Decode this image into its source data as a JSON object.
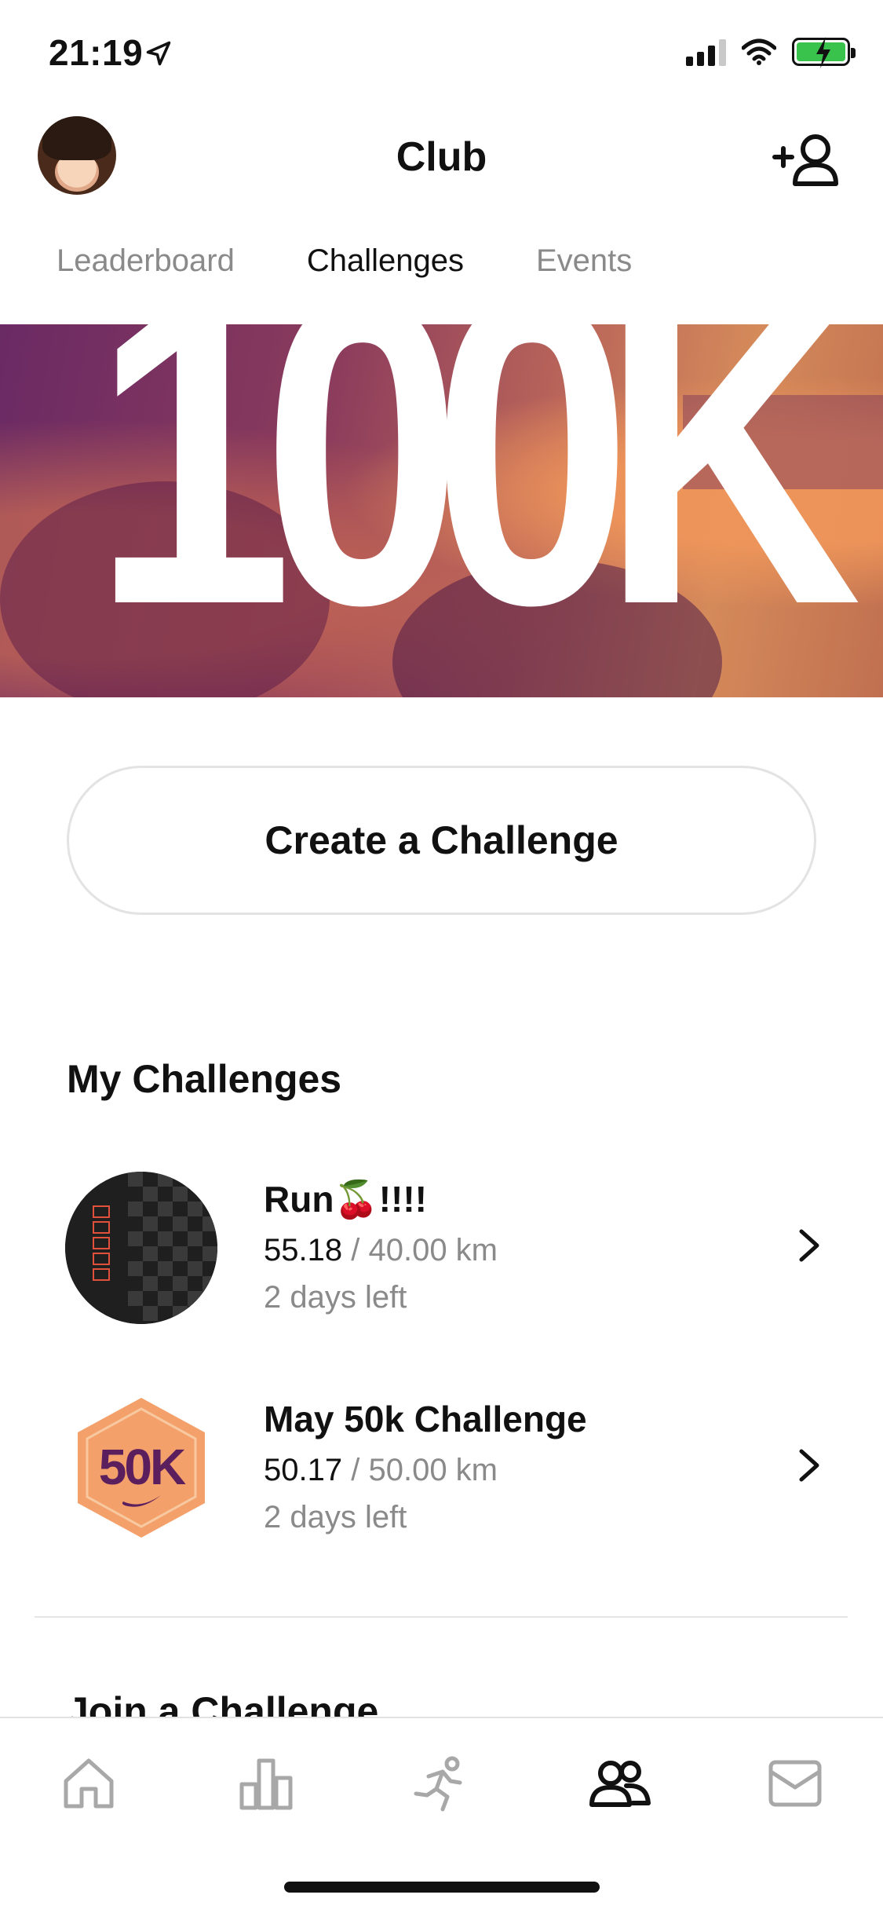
{
  "status_bar": {
    "time": "21:19",
    "battery_color": "#39c34d"
  },
  "header": {
    "title": "Club"
  },
  "tabs": [
    {
      "label": "Leaderboard",
      "active": false
    },
    {
      "label": "Challenges",
      "active": true
    },
    {
      "label": "Events",
      "active": false
    }
  ],
  "hero": {
    "text": "100K",
    "colors": [
      "#6a2a64",
      "#d58a5a"
    ]
  },
  "create_button": {
    "label": "Create a Challenge"
  },
  "my_challenges": {
    "title": "My Challenges",
    "items": [
      {
        "title": "Run🍒!!!!",
        "progress": "55.18",
        "goal": "/ 40.00 km",
        "days_left": "2 days left",
        "badge": "checkered-badge"
      },
      {
        "title": "May 50k Challenge",
        "progress": "50.17",
        "goal": "/ 50.00 km",
        "days_left": "2 days left",
        "badge_text": "50K",
        "badge": "50k-hexagon-badge"
      }
    ]
  },
  "join": {
    "title": "Join a Challenge"
  },
  "tabbar": {
    "items": [
      "home-icon",
      "activity-icon",
      "run-icon",
      "club-icon",
      "inbox-icon"
    ],
    "active": "club-icon"
  },
  "colors": {
    "accent": "#111111",
    "muted": "#8a8a8a",
    "badge_orange": "#f3a06a",
    "badge_purple": "#5b1f5e"
  }
}
